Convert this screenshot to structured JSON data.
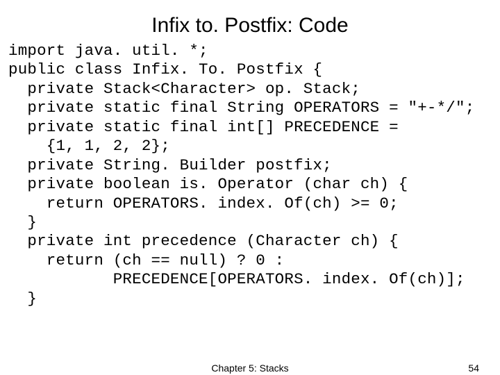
{
  "slide": {
    "title": "Infix to. Postfix: Code",
    "code_lines": [
      "import java. util. *;",
      "public class Infix. To. Postfix {",
      "  private Stack<Character> op. Stack;",
      "  private static final String OPERATORS = \"+-*/\";",
      "  private static final int[] PRECEDENCE =",
      "    {1, 1, 2, 2};",
      "  private String. Builder postfix;",
      "  private boolean is. Operator (char ch) {",
      "    return OPERATORS. index. Of(ch) >= 0;",
      "  }",
      "  private int precedence (Character ch) {",
      "    return (ch == null) ? 0 :",
      "           PRECEDENCE[OPERATORS. index. Of(ch)];",
      "  }"
    ],
    "footer_chapter": "Chapter 5: Stacks",
    "footer_page": "54"
  }
}
